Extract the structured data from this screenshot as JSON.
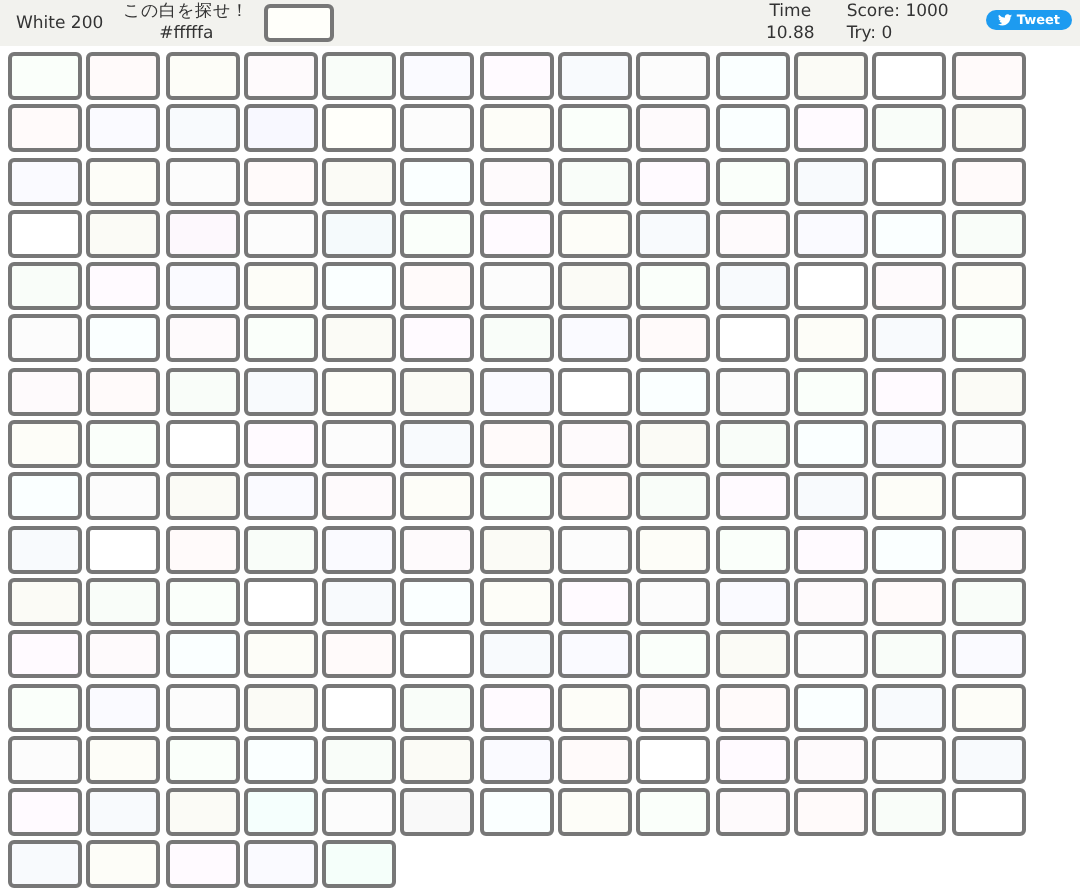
{
  "header": {
    "title": "White 200",
    "prompt": "この白を探せ！",
    "target_code": "#fffffa",
    "time_label": "Time",
    "time_value": "10.88",
    "score": "Score: 1000",
    "tries": "Try: 0",
    "tweet_button": "Tweet"
  },
  "tiles": [
    {
      "color": "#fafffa"
    },
    {
      "color": "#fffafa"
    },
    {
      "color": "#fdfdf8"
    },
    {
      "color": "#fefafc"
    },
    {
      "color": "#f9fdf9"
    },
    {
      "color": "#fafaff"
    },
    {
      "color": "#fffaff"
    },
    {
      "color": "#f8fafd"
    },
    {
      "color": "#fcfcfc"
    },
    {
      "color": "#faffff"
    },
    {
      "color": "#fbfbf6"
    },
    {
      "color": "#ffffff"
    },
    {
      "color": "#fffafa"
    },
    {
      "color": "#fffafa"
    },
    {
      "color": "#fafaff"
    },
    {
      "color": "#f8fafd"
    },
    {
      "color": "#f8f8ff"
    },
    {
      "color": "#fffffa"
    },
    {
      "color": "#fcfcfc"
    },
    {
      "color": "#fdfdf8"
    },
    {
      "color": "#fafffa"
    },
    {
      "color": "#fefafc"
    },
    {
      "color": "#faffff"
    },
    {
      "color": "#fffaff"
    },
    {
      "color": "#f9fdf9"
    },
    {
      "color": "#fbfbf6"
    },
    {
      "color": "#fafaff"
    },
    {
      "color": "#fdfdf8"
    },
    {
      "color": "#fcfcfc"
    },
    {
      "color": "#fffafa"
    },
    {
      "color": "#fbfbf6"
    },
    {
      "color": "#faffff"
    },
    {
      "color": "#fefafc"
    },
    {
      "color": "#f9fdf9"
    },
    {
      "color": "#fffaff"
    },
    {
      "color": "#fafffa"
    },
    {
      "color": "#f8fafd"
    },
    {
      "color": "#ffffff"
    },
    {
      "color": "#fffafa"
    },
    {
      "color": "#ffffff"
    },
    {
      "color": "#fbfbf6"
    },
    {
      "color": "#fdf8fd"
    },
    {
      "color": "#fcfcfc"
    },
    {
      "color": "#f5fafc"
    },
    {
      "color": "#fafffa"
    },
    {
      "color": "#fffaff"
    },
    {
      "color": "#fdfdf8"
    },
    {
      "color": "#f8fafd"
    },
    {
      "color": "#fefafc"
    },
    {
      "color": "#fafaff"
    },
    {
      "color": "#faffff"
    },
    {
      "color": "#f9fdf9"
    },
    {
      "color": "#f9fdf9"
    },
    {
      "color": "#fffaff"
    },
    {
      "color": "#fafaff"
    },
    {
      "color": "#fdfdf8"
    },
    {
      "color": "#faffff"
    },
    {
      "color": "#fffafa"
    },
    {
      "color": "#fcfcfc"
    },
    {
      "color": "#fbfbf6"
    },
    {
      "color": "#fafffa"
    },
    {
      "color": "#f8fafd"
    },
    {
      "color": "#ffffff"
    },
    {
      "color": "#fefafc"
    },
    {
      "color": "#fdfdf8"
    },
    {
      "color": "#fcfcfc"
    },
    {
      "color": "#faffff"
    },
    {
      "color": "#fefafc"
    },
    {
      "color": "#fafffa"
    },
    {
      "color": "#fbfbf6"
    },
    {
      "color": "#fffaff"
    },
    {
      "color": "#f9fdf9"
    },
    {
      "color": "#fafaff"
    },
    {
      "color": "#fffafa"
    },
    {
      "color": "#ffffff"
    },
    {
      "color": "#fdfdf8"
    },
    {
      "color": "#f8fafd"
    },
    {
      "color": "#fafffa"
    },
    {
      "color": "#fefafc"
    },
    {
      "color": "#fffafa"
    },
    {
      "color": "#f9fdf9"
    },
    {
      "color": "#f8fafd"
    },
    {
      "color": "#fdfdf8"
    },
    {
      "color": "#fbfbf6"
    },
    {
      "color": "#fafaff"
    },
    {
      "color": "#ffffff"
    },
    {
      "color": "#faffff"
    },
    {
      "color": "#fcfcfc"
    },
    {
      "color": "#fafffa"
    },
    {
      "color": "#fffaff"
    },
    {
      "color": "#fbfbf6"
    },
    {
      "color": "#fdfdf8"
    },
    {
      "color": "#fafffa"
    },
    {
      "color": "#ffffff"
    },
    {
      "color": "#fffaff"
    },
    {
      "color": "#fcfcfc"
    },
    {
      "color": "#f8fafd"
    },
    {
      "color": "#fffafa"
    },
    {
      "color": "#fefafc"
    },
    {
      "color": "#fbfbf6"
    },
    {
      "color": "#f9fdf9"
    },
    {
      "color": "#faffff"
    },
    {
      "color": "#fafaff"
    },
    {
      "color": "#fcfcfc"
    },
    {
      "color": "#faffff"
    },
    {
      "color": "#fcfcfc"
    },
    {
      "color": "#fbfbf6"
    },
    {
      "color": "#fafaff"
    },
    {
      "color": "#fefafc"
    },
    {
      "color": "#fdfdf8"
    },
    {
      "color": "#fafffa"
    },
    {
      "color": "#fffafa"
    },
    {
      "color": "#f9fdf9"
    },
    {
      "color": "#fffaff"
    },
    {
      "color": "#f8fafd"
    },
    {
      "color": "#fdfdf8"
    },
    {
      "color": "#ffffff"
    },
    {
      "color": "#f8fafd"
    },
    {
      "color": "#ffffff"
    },
    {
      "color": "#fffafa"
    },
    {
      "color": "#f9fdf9"
    },
    {
      "color": "#fafaff"
    },
    {
      "color": "#fefafc"
    },
    {
      "color": "#fbfbf6"
    },
    {
      "color": "#fcfcfc"
    },
    {
      "color": "#fdfdf8"
    },
    {
      "color": "#fafffa"
    },
    {
      "color": "#fffaff"
    },
    {
      "color": "#faffff"
    },
    {
      "color": "#fefafc"
    },
    {
      "color": "#fbfbf6"
    },
    {
      "color": "#f9fdf9"
    },
    {
      "color": "#fafffa"
    },
    {
      "color": "#ffffff"
    },
    {
      "color": "#f8fafd"
    },
    {
      "color": "#faffff"
    },
    {
      "color": "#fdfdf8"
    },
    {
      "color": "#fffaff"
    },
    {
      "color": "#fcfcfc"
    },
    {
      "color": "#fafaff"
    },
    {
      "color": "#fefafc"
    },
    {
      "color": "#fffafa"
    },
    {
      "color": "#f9fdf9"
    },
    {
      "color": "#fffaff"
    },
    {
      "color": "#fefafc"
    },
    {
      "color": "#faffff"
    },
    {
      "color": "#fdfdf8"
    },
    {
      "color": "#fffafa"
    },
    {
      "color": "#ffffff"
    },
    {
      "color": "#f8fafd"
    },
    {
      "color": "#fafaff"
    },
    {
      "color": "#fafffa"
    },
    {
      "color": "#fbfbf6"
    },
    {
      "color": "#fcfcfc"
    },
    {
      "color": "#f9fdf9"
    },
    {
      "color": "#fafaff"
    },
    {
      "color": "#fafffa"
    },
    {
      "color": "#fafaff"
    },
    {
      "color": "#fcfcfc"
    },
    {
      "color": "#fbfbf6"
    },
    {
      "color": "#ffffff"
    },
    {
      "color": "#f9fdf9"
    },
    {
      "color": "#fffaff"
    },
    {
      "color": "#fdfdf8"
    },
    {
      "color": "#fefafc"
    },
    {
      "color": "#fffafa"
    },
    {
      "color": "#faffff"
    },
    {
      "color": "#f8fafd"
    },
    {
      "color": "#fdfdf8"
    },
    {
      "color": "#fcfcfc"
    },
    {
      "color": "#fdfdf8"
    },
    {
      "color": "#fafffa"
    },
    {
      "color": "#faffff"
    },
    {
      "color": "#f9fdf9"
    },
    {
      "color": "#fbfbf6"
    },
    {
      "color": "#fafaff"
    },
    {
      "color": "#fffafa"
    },
    {
      "color": "#ffffff"
    },
    {
      "color": "#fffaff"
    },
    {
      "color": "#fefafc"
    },
    {
      "color": "#fcfcfc"
    },
    {
      "color": "#f8fafd"
    },
    {
      "color": "#fffaff"
    },
    {
      "color": "#f8fafd"
    },
    {
      "color": "#fbfbf6"
    },
    {
      "color": "#f5fffd"
    },
    {
      "color": "#fcfcfc"
    },
    {
      "color": "#f9f9f9"
    },
    {
      "color": "#faffff"
    },
    {
      "color": "#fdfdf8"
    },
    {
      "color": "#fafffa"
    },
    {
      "color": "#fefafc"
    },
    {
      "color": "#fffafa"
    },
    {
      "color": "#f9fdf9"
    },
    {
      "color": "#ffffff"
    },
    {
      "color": "#f8fafd"
    },
    {
      "color": "#fdfdf8"
    },
    {
      "color": "#fffaff"
    },
    {
      "color": "#fafaff"
    },
    {
      "color": "#f5fffa"
    }
  ]
}
